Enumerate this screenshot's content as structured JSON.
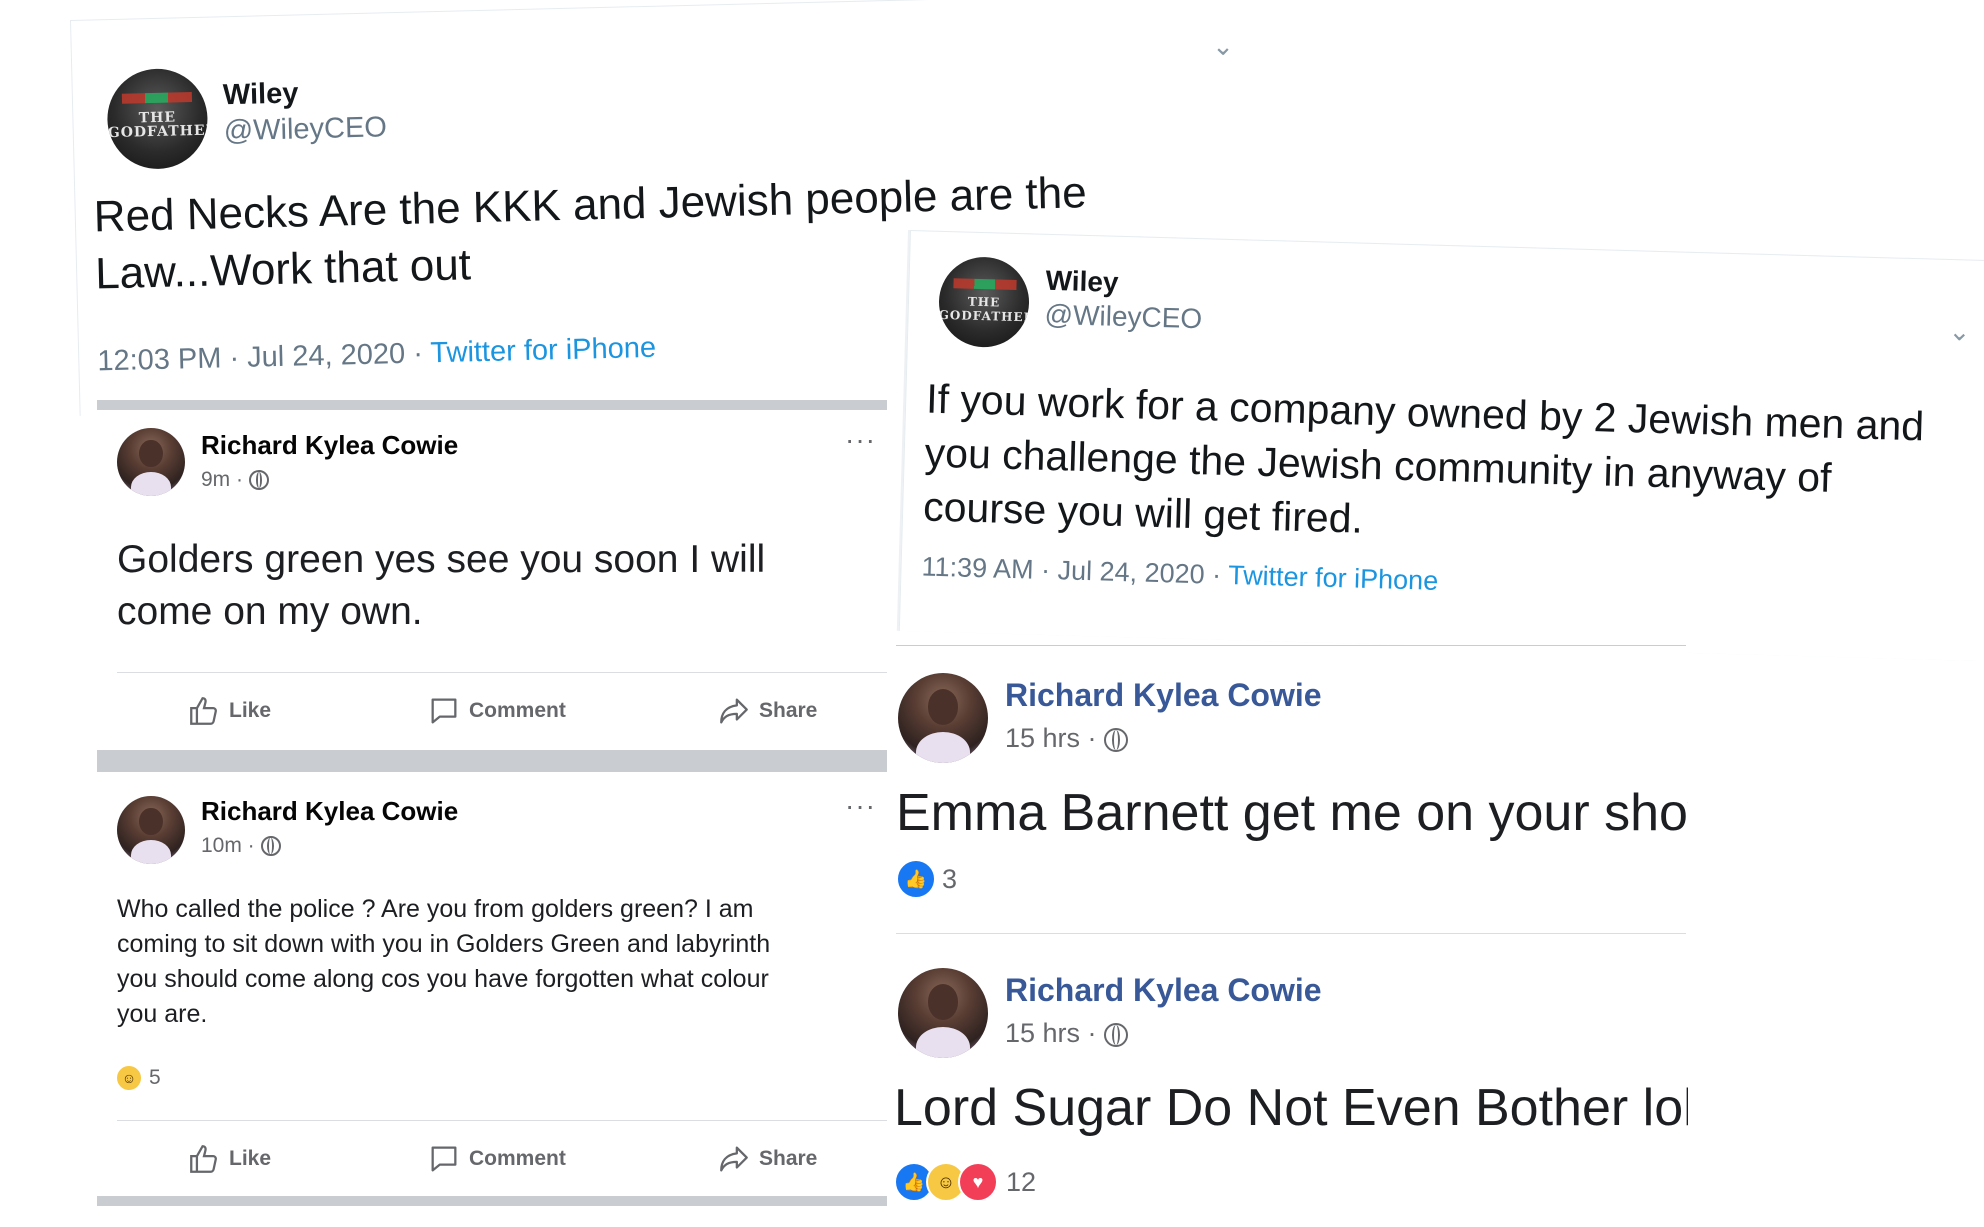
{
  "tweet1": {
    "name": "Wiley",
    "handle": "@WileyCEO",
    "text_line1": "Red Necks Are the KKK and Jewish people are the",
    "text_line2": "Law...Work that out",
    "time": "12:03 PM · Jul 24, 2020 · ",
    "source": "Twitter for iPhone",
    "avatar_text": "THE GODFATHER"
  },
  "tweet2": {
    "name": "Wiley",
    "handle": "@WileyCEO",
    "text_line1": "If you work for a company owned by 2 Jewish men and",
    "text_line2": "you challenge the Jewish community in anyway of",
    "text_line3": "course you will get fired.",
    "time": "11:39 AM · Jul 24, 2020 · ",
    "source": "Twitter for iPhone",
    "avatar_text": "THE GODFATHER"
  },
  "fb1": {
    "name": "Richard Kylea Cowie",
    "time": "9m · ",
    "text_line1": "Golders green yes see you soon I will",
    "text_line2": "come on my own.",
    "like": "Like",
    "comment": "Comment",
    "share": "Share"
  },
  "fb2": {
    "name": "Richard Kylea Cowie",
    "time": "10m · ",
    "text_line1": "Who called the police ? Are you from golders green?  I am",
    "text_line2": "coming to sit down with you in Golders Green and labyrinth",
    "text_line3": "you should come along cos you have forgotten what colour",
    "text_line4": "you are.",
    "reaction_count": "5",
    "like": "Like",
    "comment": "Comment",
    "share": "Share"
  },
  "fb3": {
    "name": "Richard Kylea Cowie",
    "time": "15 hrs · ",
    "text": "Emma Barnett get me on your show",
    "reaction_count": "3"
  },
  "fb4": {
    "name": "Richard Kylea Cowie",
    "time": "15 hrs · ",
    "text": "Lord Sugar Do Not Even Bother lol",
    "reaction_count": "12"
  }
}
